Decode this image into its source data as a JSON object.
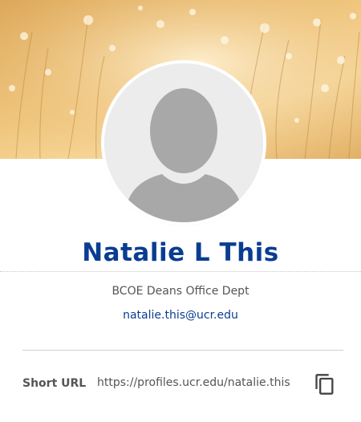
{
  "profile": {
    "name": "Natalie L This",
    "department": "BCOE Deans Office Dept",
    "email": "natalie.this@ucr.edu",
    "short_url_label": "Short URL",
    "short_url": "https://profiles.ucr.edu/natalie.this"
  },
  "icons": {
    "avatar": "person-silhouette-icon",
    "copy": "copy-icon"
  },
  "colors": {
    "name": "#0a3d91",
    "link": "#0a3d91",
    "text": "#555555",
    "banner": "#f0c77f"
  }
}
